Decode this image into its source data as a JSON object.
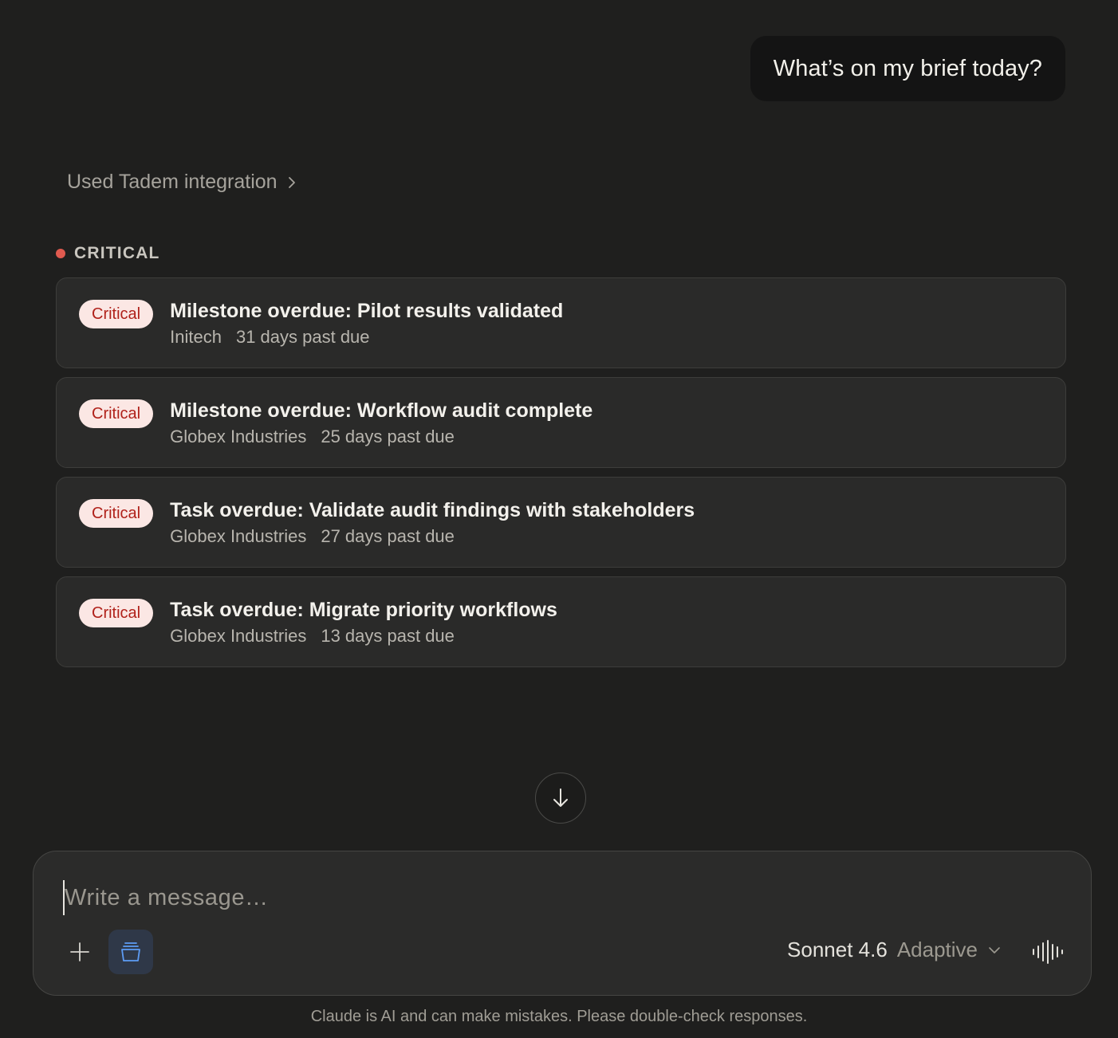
{
  "conversation": {
    "user_message": "What’s on my brief today?",
    "tool_use_label": "Used Tadem integration"
  },
  "brief": {
    "section_label": "CRITICAL",
    "section_color": "#e05a4f",
    "items": [
      {
        "badge": "Critical",
        "title": "Milestone overdue: Pilot results validated",
        "company": "Initech",
        "due": "31 days past due"
      },
      {
        "badge": "Critical",
        "title": "Milestone overdue: Workflow audit complete",
        "company": "Globex Industries",
        "due": "25 days past due"
      },
      {
        "badge": "Critical",
        "title": "Task overdue: Validate audit findings with stakeholders",
        "company": "Globex Industries",
        "due": "27 days past due"
      },
      {
        "badge": "Critical",
        "title": "Task overdue: Migrate priority workflows",
        "company": "Globex Industries",
        "due": "13 days past due"
      }
    ]
  },
  "composer": {
    "placeholder": "Write a message…",
    "value": "",
    "model_name": "Sonnet 4.6",
    "model_mode": "Adaptive",
    "icons": {
      "scroll": "arrow-down-icon",
      "add": "plus-icon",
      "tool": "tadem-icon",
      "mode_dropdown": "chevron-down-icon",
      "voice": "voice-waveform-icon"
    }
  },
  "footer": {
    "disclaimer": "Claude is AI and can make mistakes. Please double-check responses."
  }
}
